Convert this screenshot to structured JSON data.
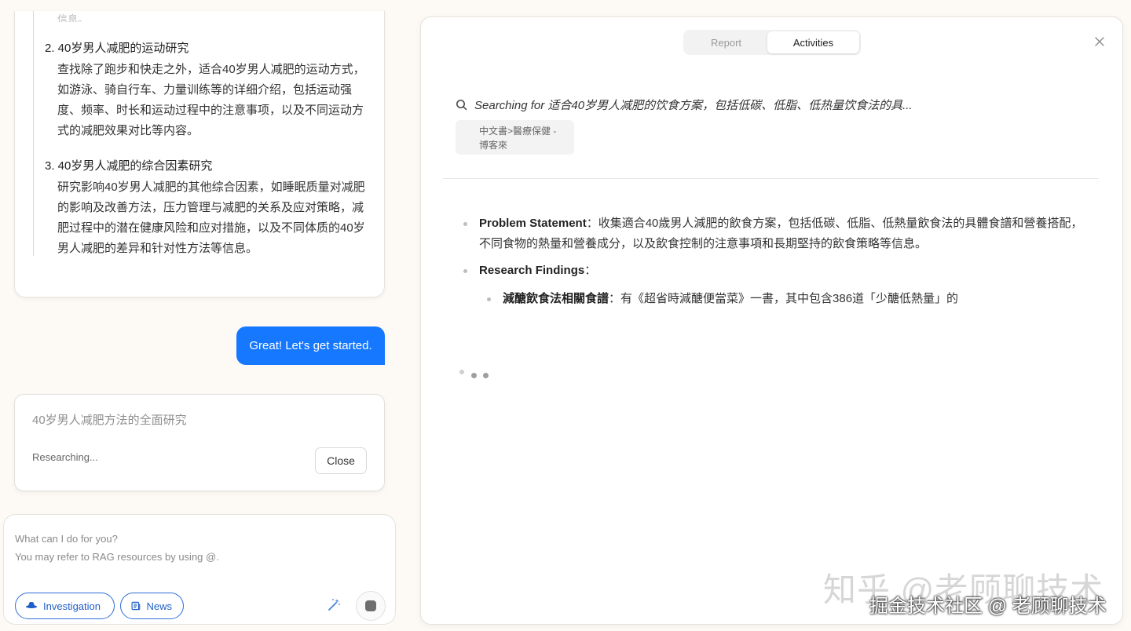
{
  "plan": {
    "faded_text": "信息。",
    "items": [
      {
        "title": "2. 40岁男人减肥的运动研究",
        "desc": "查找除了跑步和快走之外，适合40岁男人减肥的运动方式，如游泳、骑自行车、力量训练等的详细介绍，包括运动强度、频率、时长和运动过程中的注意事项，以及不同运动方式的减肥效果对比等内容。"
      },
      {
        "title": "3. 40岁男人减肥的综合因素研究",
        "desc": "研究影响40岁男人减肥的其他综合因素，如睡眠质量对减肥的影响及改善方法，压力管理与减肥的关系及应对策略，减肥过程中的潜在健康风险和应对措施，以及不同体质的40岁男人减肥的差异和针对性方法等信息。"
      }
    ]
  },
  "user_message": "Great! Let's get started.",
  "research_card": {
    "title": "40岁男人减肥方法的全面研究",
    "status": "Researching...",
    "close_label": "Close"
  },
  "input": {
    "placeholder_line1": "What can I do for you?",
    "placeholder_line2": "You may refer to RAG resources by using @.",
    "investigation_label": "Investigation",
    "news_label": "News"
  },
  "panel": {
    "tabs": [
      "Report",
      "Activities"
    ],
    "active_tab": "Activities",
    "search_text": "Searching for 适合40岁男人减肥的饮食方案，包括低碳、低脂、低热量饮食法的具...",
    "source_chip": "中文書>醫療保健 - 博客來",
    "findings": {
      "problem_label": "Problem Statement",
      "problem_text": "：收集適合40歲男人減肥的飲食方案，包括低碳、低脂、低熱量飲食法的具體食譜和營養搭配，不同食物的熱量和營養成分，以及飲食控制的注意事項和長期堅持的飲食策略等信息。",
      "research_label": "Research Findings",
      "research_suffix": "：",
      "sub_label": "減醣飲食法相關食譜",
      "sub_text": "：有《超省時減醣便當菜》一書，其中包含386道「少醣低熱量」的"
    }
  },
  "watermark": {
    "line1": "知乎 @老顾聊技术",
    "line2": "掘金技术社区 @ 老顾聊技术"
  },
  "colors": {
    "accent": "#1677ff",
    "pill_border": "#2f6fd8",
    "background": "#fdf9f4"
  },
  "icons": {
    "search": "search-icon",
    "close": "close-icon",
    "investigation": "detective-hat-icon",
    "news": "newspaper-icon",
    "enhance": "magic-wand-icon",
    "stop": "stop-icon"
  }
}
